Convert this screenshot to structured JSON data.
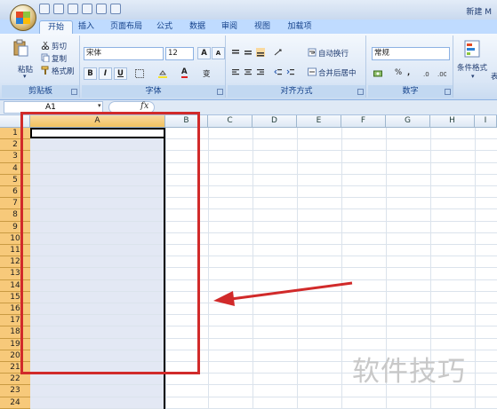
{
  "window": {
    "title_partial": "新建 M"
  },
  "tabs": [
    {
      "label": "开始",
      "active": true
    },
    {
      "label": "插入"
    },
    {
      "label": "页面布局"
    },
    {
      "label": "公式"
    },
    {
      "label": "数据"
    },
    {
      "label": "审阅"
    },
    {
      "label": "视图"
    },
    {
      "label": "加载项"
    }
  ],
  "clipboard": {
    "paste": "粘贴",
    "cut": "剪切",
    "copy": "复制",
    "format_painter": "格式刷",
    "label": "剪贴板"
  },
  "font": {
    "family": "宋体",
    "size": "12",
    "label": "字体",
    "bold": "B",
    "italic": "I",
    "underline": "U",
    "grow": "A",
    "shrink": "A",
    "color_letter": "A",
    "phonetic": "变"
  },
  "alignment": {
    "wrap": "自动换行",
    "merge": "合并后居中",
    "label": "对齐方式"
  },
  "number": {
    "format": "常规",
    "percent": "%",
    "comma": ",",
    "label": "数字"
  },
  "styles": {
    "conditional": "条件格式",
    "table_partial": "表"
  },
  "formula_bar": {
    "name_box": "A1",
    "fx": "fx"
  },
  "columns": [
    "A",
    "B",
    "C",
    "D",
    "E",
    "F",
    "G",
    "H",
    "I"
  ],
  "rows": [
    "1",
    "2",
    "3",
    "4",
    "5",
    "6",
    "7",
    "8",
    "9",
    "10",
    "11",
    "12",
    "13",
    "14",
    "15",
    "16",
    "17",
    "18",
    "19",
    "20",
    "21",
    "22",
    "23",
    "24"
  ],
  "annotation": {
    "watermark": "软件技巧",
    "highlight_color": "#d12a2a",
    "accent": "#f7c97a"
  }
}
